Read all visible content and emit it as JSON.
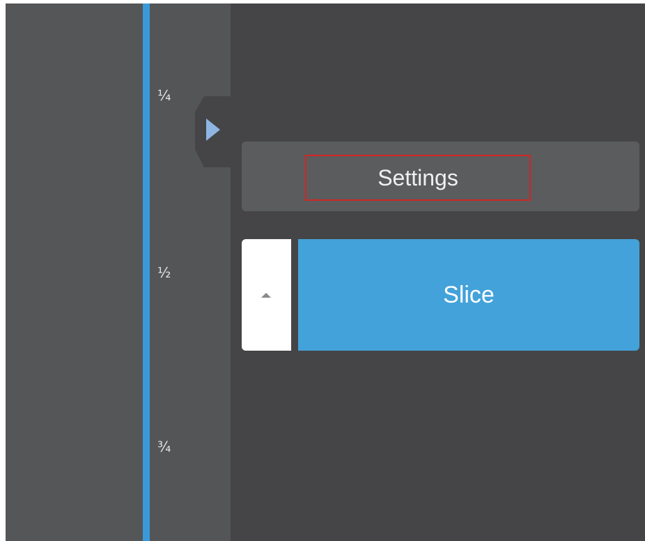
{
  "ruler": {
    "ticks": [
      "¼",
      "½",
      "¾"
    ]
  },
  "marker": {
    "icon": "play-arrow-icon"
  },
  "buttons": {
    "settings_label": "Settings",
    "slice_label": "Slice",
    "collapse_icon": "caret-up-icon"
  },
  "colors": {
    "accent": "#3a9ad9",
    "slice_button": "#43a2d9",
    "background": "#454547",
    "highlight_border": "#d22525"
  }
}
